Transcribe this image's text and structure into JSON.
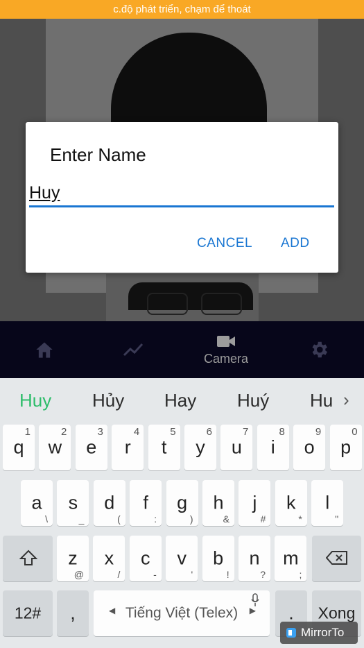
{
  "status": {
    "dev_banner": "c.độ phát triển, chạm để thoát"
  },
  "bottom_nav": {
    "items": [
      {
        "icon": "home-icon",
        "label": ""
      },
      {
        "icon": "trending-icon",
        "label": ""
      },
      {
        "icon": "videocam-icon",
        "label": "Camera"
      },
      {
        "icon": "settings-icon",
        "label": ""
      }
    ]
  },
  "dialog": {
    "title": "Enter Name",
    "input_value": "Huy",
    "cancel_label": "CANCEL",
    "add_label": "ADD"
  },
  "keyboard": {
    "suggestions": [
      "Huy",
      "Hủy",
      "Hay",
      "Huý",
      "Hu"
    ],
    "row1": [
      {
        "key": "q",
        "hint": "1"
      },
      {
        "key": "w",
        "hint": "2"
      },
      {
        "key": "e",
        "hint": "3"
      },
      {
        "key": "r",
        "hint": "4"
      },
      {
        "key": "t",
        "hint": "5"
      },
      {
        "key": "y",
        "hint": "6"
      },
      {
        "key": "u",
        "hint": "7"
      },
      {
        "key": "i",
        "hint": "8"
      },
      {
        "key": "o",
        "hint": "9"
      },
      {
        "key": "p",
        "hint": "0"
      }
    ],
    "row2": [
      {
        "key": "a",
        "sub": "\\"
      },
      {
        "key": "s",
        "sub": "_"
      },
      {
        "key": "d",
        "sub": "("
      },
      {
        "key": "f",
        "sub": ":"
      },
      {
        "key": "g",
        "sub": ")"
      },
      {
        "key": "h",
        "sub": "&"
      },
      {
        "key": "j",
        "sub": "#"
      },
      {
        "key": "k",
        "sub": "*"
      },
      {
        "key": "l",
        "sub": "\""
      }
    ],
    "row3": [
      {
        "key": "z",
        "sub": "@"
      },
      {
        "key": "x",
        "sub": "/"
      },
      {
        "key": "c",
        "sub": "-"
      },
      {
        "key": "v",
        "sub": "'"
      },
      {
        "key": "b",
        "sub": "!"
      },
      {
        "key": "n",
        "sub": "?"
      },
      {
        "key": "m",
        "sub": ";"
      }
    ],
    "shift_icon": "shift-icon",
    "backspace_icon": "backspace-icon",
    "symbols_label": "12#",
    "comma_label": ",",
    "space_label": "Tiếng Việt (Telex)",
    "mic_icon": "microphone-icon",
    "period_label": ".",
    "enter_label": "Xong"
  },
  "overlay": {
    "mirror_badge": "MirrorTo"
  }
}
